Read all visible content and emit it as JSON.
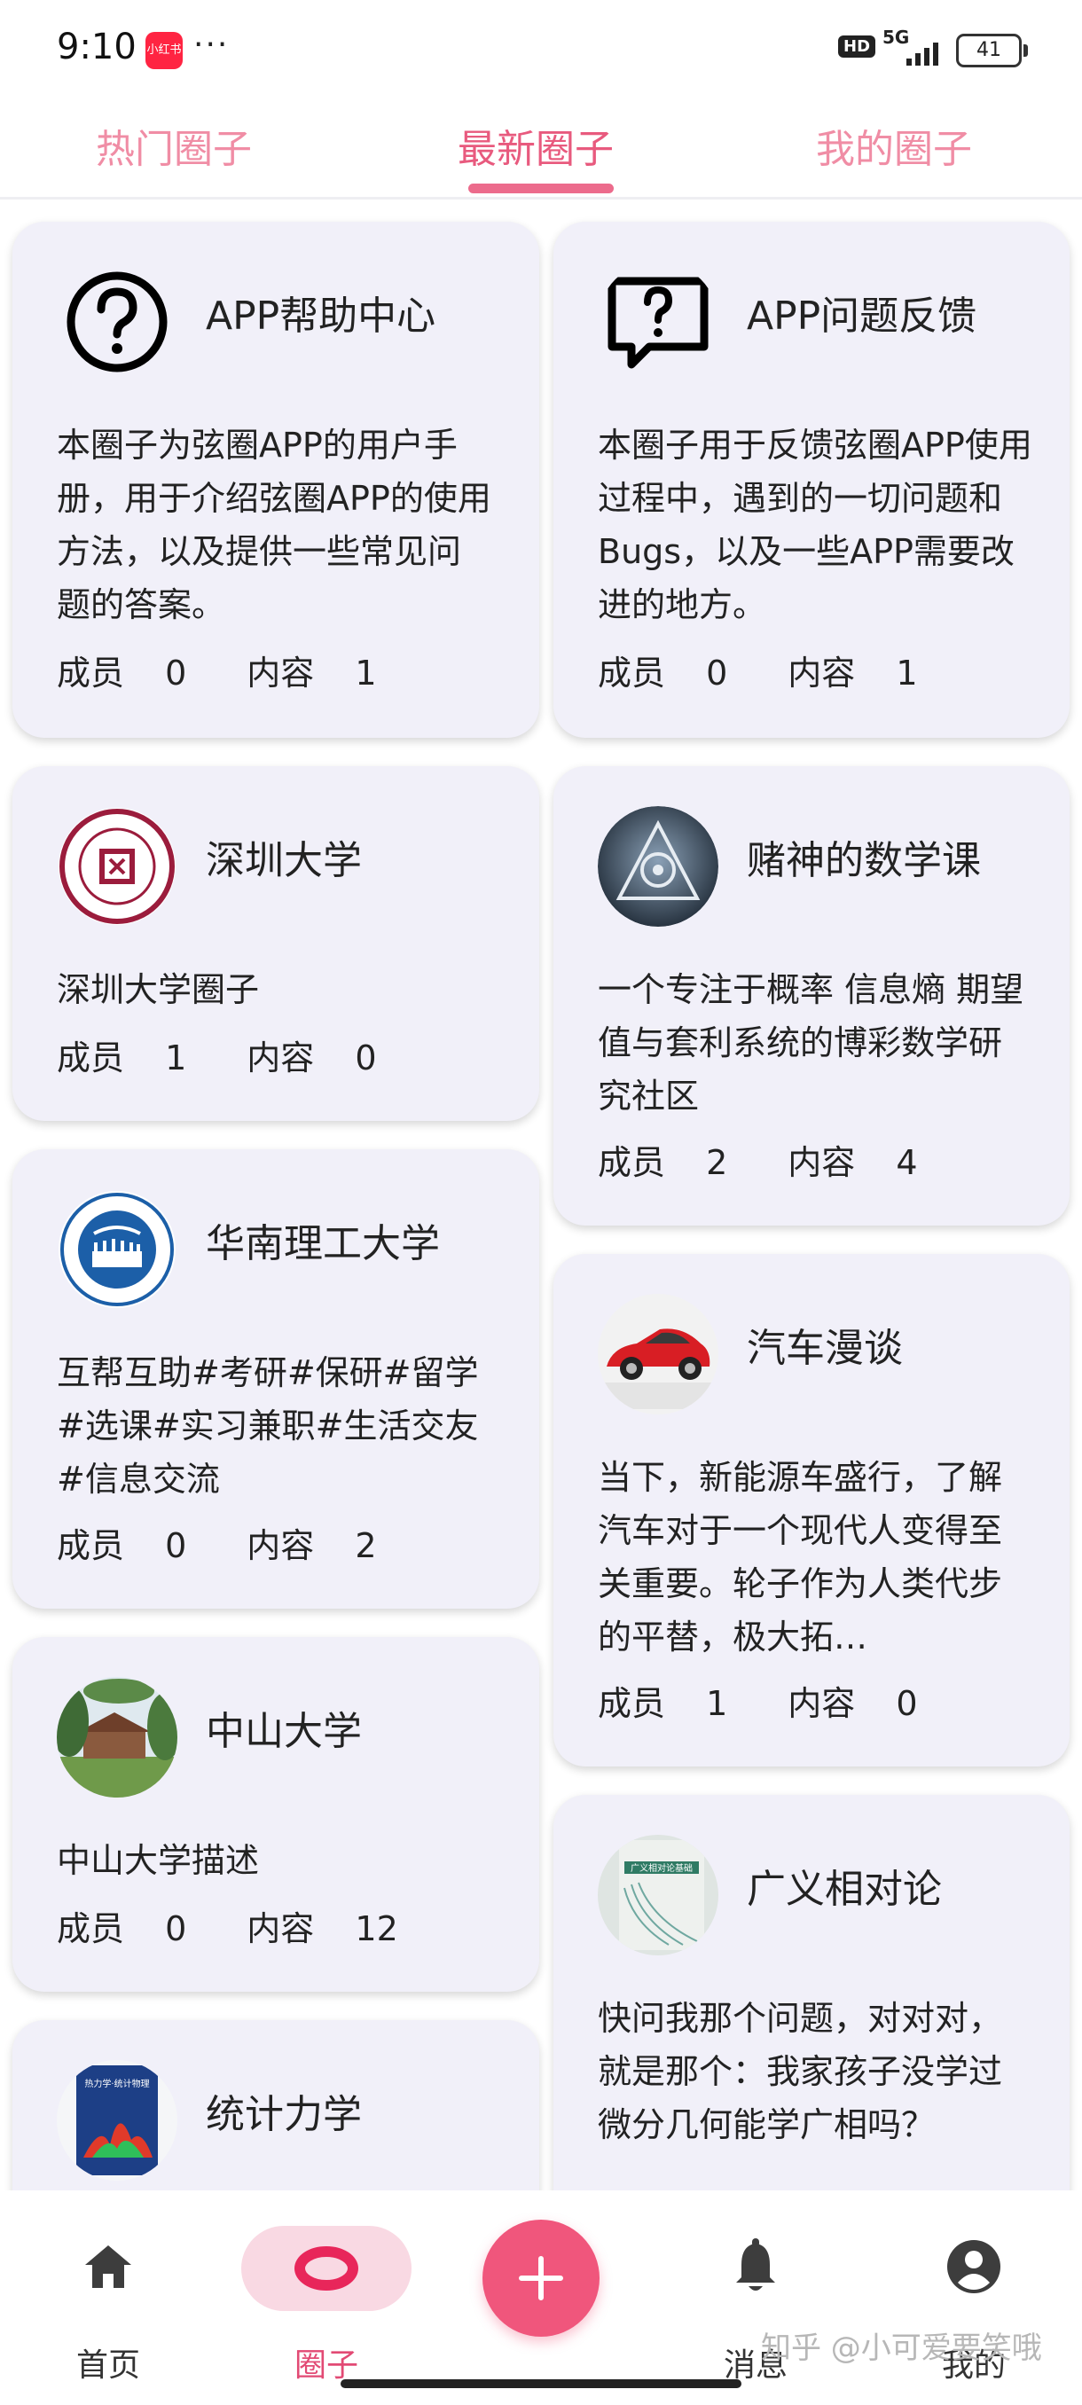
{
  "status_bar": {
    "time": "9:10",
    "app_badge": "小红书",
    "hd": "HD",
    "network": "5G",
    "battery": "41"
  },
  "tabs": [
    {
      "label": "热门圈子",
      "active": false
    },
    {
      "label": "最新圈子",
      "active": true
    },
    {
      "label": "我的圈子",
      "active": false
    }
  ],
  "stats_labels": {
    "members": "成员",
    "content": "内容"
  },
  "left_column": [
    {
      "title": "APP帮助中心",
      "icon": "question-circle-icon",
      "description": "本圈子为弦圈APP的用户手册，用于介绍弦圈APP的使用方法，以及提供一些常见问题的答案。",
      "members": "0",
      "content": "1"
    },
    {
      "title": "深圳大学",
      "icon": "shenzhen-university-logo",
      "description": "深圳大学圈子",
      "members": "1",
      "content": "0"
    },
    {
      "title": "华南理工大学",
      "icon": "scut-logo",
      "description": "互帮互助#考研#保研#留学#选课#实习兼职#生活交友#信息交流",
      "members": "0",
      "content": "2"
    },
    {
      "title": "中山大学",
      "icon": "sun-yat-sen-campus-photo",
      "description": "中山大学描述",
      "members": "0",
      "content": "12"
    },
    {
      "title": "统计力学",
      "icon": "statistical-mechanics-book-cover",
      "description": "",
      "members": "",
      "content": ""
    }
  ],
  "right_column": [
    {
      "title": "APP问题反馈",
      "icon": "question-bubble-icon",
      "description": "本圈子用于反馈弦圈APP使用过程中，遇到的一切问题和Bugs，以及一些APP需要改进的地方。",
      "members": "0",
      "content": "1"
    },
    {
      "title": "赌神的数学课",
      "icon": "triangle-eye-icon",
      "description": "一个专注于概率 信息熵 期望值与套利系统的博彩数学研究社区",
      "members": "2",
      "content": "4"
    },
    {
      "title": "汽车漫谈",
      "icon": "red-car-photo",
      "description": "当下，新能源车盛行，了解汽车对于一个现代人变得至关重要。轮子作为人类代步的平替，极大拓…",
      "members": "1",
      "content": "0"
    },
    {
      "title": "广义相对论",
      "icon": "general-relativity-book-cover",
      "description": "快问我那个问题，对对对，就是那个：我家孩子没学过微分几何能学广相吗？",
      "members": "",
      "content": ""
    }
  ],
  "book_cover_texts": {
    "general_relativity": "广义相对论基础",
    "statistical_mechanics": "热力学·统计物理"
  },
  "bottom_nav": [
    {
      "label": "首页",
      "icon": "home-icon",
      "active": false
    },
    {
      "label": "圈子",
      "icon": "circle-ring-icon",
      "active": true
    },
    {
      "label": "",
      "icon": "plus-icon",
      "active": false
    },
    {
      "label": "消息",
      "icon": "bell-icon",
      "active": false
    },
    {
      "label": "我的",
      "icon": "account-circle-icon",
      "active": false
    }
  ],
  "watermark": "知乎 @小可爱要笑哦",
  "colors": {
    "accent": "#e85a7e",
    "card_bg": "#f1f0f9",
    "fab": "#f0567c",
    "nav_pill": "#f9d9e3"
  }
}
